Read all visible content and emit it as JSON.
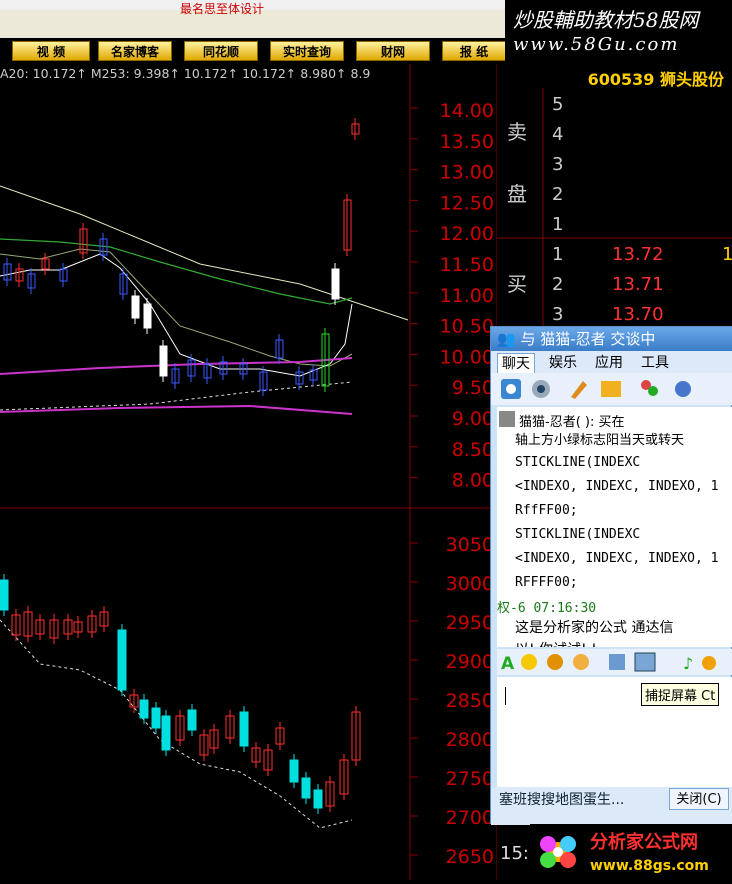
{
  "window": {
    "title_fragment": "最名思至体设计"
  },
  "toolbar": {
    "buttons": [
      "视 频",
      "名家博客",
      "同花顺",
      "实时查询",
      "财网",
      "报 纸"
    ]
  },
  "brand": {
    "line1": "炒股輔助教材58股网",
    "line2": "www.58Gu.com"
  },
  "stock": {
    "code_name": "600539 狮头股份"
  },
  "ma_legend": {
    "text": "A20: 10.172↑ M253: 9.398↑ 10.172↑ 10.172↑ 8.980↑ 8.9"
  },
  "price_axis": {
    "labels": [
      "14.00",
      "13.50",
      "13.00",
      "12.50",
      "12.00",
      "11.50",
      "11.00",
      "10.50",
      "10.00",
      "9.50",
      "9.00",
      "8.50",
      "8.00"
    ]
  },
  "index_axis": {
    "labels": [
      "3050",
      "3000",
      "2950",
      "2900",
      "2850",
      "2800",
      "2750",
      "2700",
      "2650"
    ]
  },
  "orderbook": {
    "sell_label_1": "卖",
    "sell_label_2": "盘",
    "sell_levels": [
      "5",
      "4",
      "3",
      "2",
      "1"
    ],
    "buy_label": "买",
    "buy_rows": [
      {
        "level": "1",
        "price": "13.72",
        "vol": "1"
      },
      {
        "level": "2",
        "price": "13.71",
        "vol": ""
      },
      {
        "level": "3",
        "price": "13.70",
        "vol": ""
      }
    ]
  },
  "chat": {
    "title": "与 猫猫-忍者 交谈中",
    "tabs": [
      "聊天",
      "娱乐",
      "应用",
      "工具"
    ],
    "history": [
      "猫猫-忍者(           ): 买在",
      "轴上方小绿标志阳当天或转天",
      "STICKLINE(INDEXC",
      "<INDEXO, INDEXC, INDEXO, 1",
      "RffFF00;",
      "STICKLINE(INDEXC",
      "<INDEXO, INDEXC, INDEXO, 1",
      "RFFFF00;",
      "权-6 07:16:30",
      "这是分析家的公式 通达信",
      "以! 你试试! !"
    ],
    "tooltip": "捕捉屏幕 Ct",
    "bottom_left": "塞班搜搜地图蛋生...",
    "close_button": "关闭(C)",
    "clock_fragment": "15:"
  },
  "logo": {
    "line1": "分析家公式网",
    "line2": "www.88gs.com"
  },
  "colors": {
    "axis_red": "#cc0000",
    "up_red": "#ff3030",
    "down_cyan": "#00e0e0",
    "yellow": "#ffd000"
  }
}
